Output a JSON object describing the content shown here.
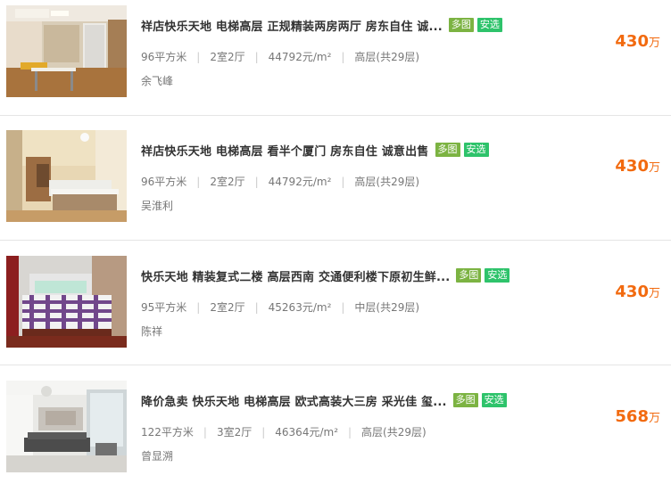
{
  "listings": [
    {
      "title": "祥店快乐天地 电梯高层 正规精装两房两厅 房东自住 诚...",
      "tags": [
        "多图",
        "安选"
      ],
      "area": "96平方米",
      "layout": "2室2厅",
      "unit_price": "44792元/m²",
      "floor": "高层(共29层)",
      "agent": "余飞峰",
      "price": "430",
      "price_unit": "万",
      "photo": "living-room-photo"
    },
    {
      "title": "祥店快乐天地 电梯高层 看半个厦门 房东自住 诚意出售",
      "tags": [
        "多图",
        "安选"
      ],
      "area": "96平方米",
      "layout": "2室2厅",
      "unit_price": "44792元/m²",
      "floor": "高层(共29层)",
      "agent": "吴淮利",
      "price": "430",
      "price_unit": "万",
      "photo": "bedroom-photo"
    },
    {
      "title": "快乐天地 精装复式二楼 高层西南 交通便利楼下原初生鲜...",
      "tags": [
        "多图",
        "安选"
      ],
      "area": "95平方米",
      "layout": "2室2厅",
      "unit_price": "45263元/m²",
      "floor": "中层(共29层)",
      "agent": "陈祥",
      "price": "430",
      "price_unit": "万",
      "photo": "bedroom-plaid-bed-photo"
    },
    {
      "title": "降价急卖 快乐天地 电梯高层 欧式高装大三房 采光佳 玺...",
      "tags": [
        "多图",
        "安选"
      ],
      "area": "122平方米",
      "layout": "3室2厅",
      "unit_price": "46364元/m²",
      "floor": "高层(共29层)",
      "agent": "曾显溯",
      "price": "568",
      "price_unit": "万",
      "photo": "living-room-sofa-photo"
    }
  ],
  "colors": {
    "price": "#f26a0f",
    "tag_multi": "#7cb342",
    "tag_safe": "#2ec36b",
    "divider": "#e5e5e5"
  }
}
